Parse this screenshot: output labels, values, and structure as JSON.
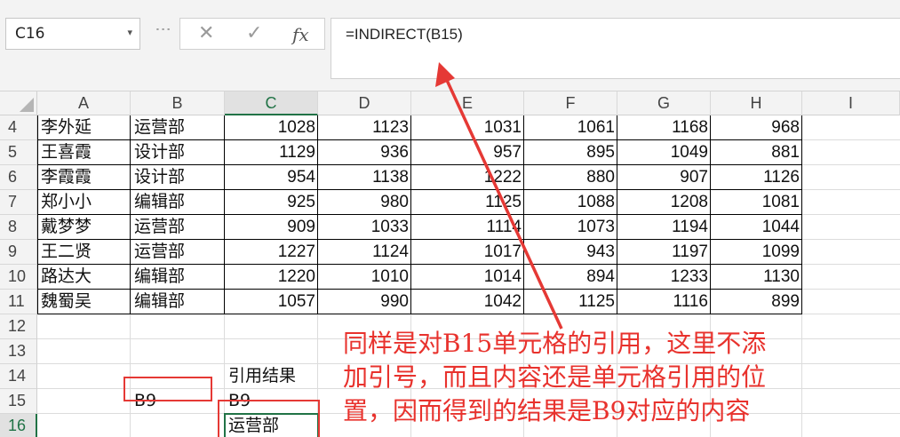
{
  "name_box": {
    "value": "C16"
  },
  "formula_bar": {
    "cancel_icon": "close-icon",
    "enter_icon": "check-icon",
    "fx_label": "fx",
    "formula": "=INDIRECT(B15)"
  },
  "columns": [
    "A",
    "B",
    "C",
    "D",
    "E",
    "F",
    "G",
    "H",
    "I"
  ],
  "selected_column": "C",
  "rows": [
    {
      "num": "4",
      "name": "李外延",
      "dept": "运营部",
      "values": [
        "1028",
        "1123",
        "1031",
        "1061",
        "1168",
        "968"
      ]
    },
    {
      "num": "5",
      "name": "王喜霞",
      "dept": "设计部",
      "values": [
        "1129",
        "936",
        "957",
        "895",
        "1049",
        "881"
      ]
    },
    {
      "num": "6",
      "name": "李霞霞",
      "dept": "设计部",
      "values": [
        "954",
        "1138",
        "1222",
        "880",
        "907",
        "1126"
      ]
    },
    {
      "num": "7",
      "name": "郑小小",
      "dept": "编辑部",
      "values": [
        "925",
        "980",
        "1125",
        "1088",
        "1208",
        "1081"
      ]
    },
    {
      "num": "8",
      "name": "戴梦梦",
      "dept": "运营部",
      "values": [
        "909",
        "1033",
        "1114",
        "1073",
        "1194",
        "1044"
      ]
    },
    {
      "num": "9",
      "name": "王二贤",
      "dept": "运营部",
      "values": [
        "1227",
        "1124",
        "1017",
        "943",
        "1197",
        "1099"
      ]
    },
    {
      "num": "10",
      "name": "路达大",
      "dept": "编辑部",
      "values": [
        "1220",
        "1010",
        "1014",
        "894",
        "1233",
        "1130"
      ]
    },
    {
      "num": "11",
      "name": "魏蜀吴",
      "dept": "编辑部",
      "values": [
        "1057",
        "990",
        "1042",
        "1125",
        "1116",
        "899"
      ]
    }
  ],
  "empty_rows": [
    "12",
    "13",
    "14",
    "15",
    "16"
  ],
  "selected_row": "16",
  "cells": {
    "c14": "引用结果",
    "b15": "B9",
    "c15": "B9",
    "c16": "运营部"
  },
  "annotation": {
    "color": "#e8322d",
    "lines": [
      "同样是对B15单元格的引用，这里不添",
      "加引号，而且内容还是单元格引用的位",
      "置，因而得到的结果是B9对应的内容"
    ]
  }
}
